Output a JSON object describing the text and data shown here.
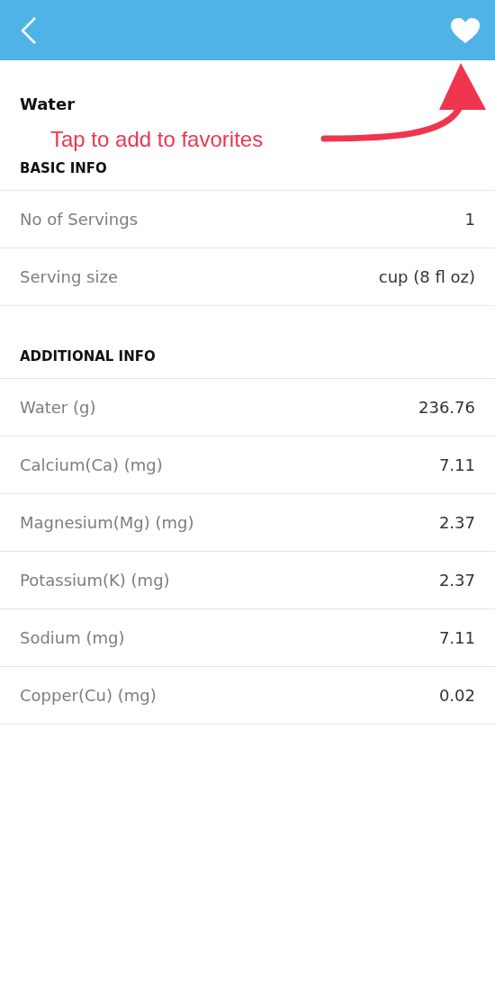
{
  "title": "Water",
  "annotation": {
    "text": "Tap to add to favorites"
  },
  "sections": [
    {
      "heading": "BASIC INFO",
      "rows": [
        {
          "label": "No of Servings",
          "value": "1"
        },
        {
          "label": "Serving size",
          "value": "cup (8 fl oz)"
        }
      ]
    },
    {
      "heading": "ADDITIONAL INFO",
      "rows": [
        {
          "label": "Water (g)",
          "value": "236.76"
        },
        {
          "label": "Calcium(Ca) (mg)",
          "value": "7.11"
        },
        {
          "label": "Magnesium(Mg) (mg)",
          "value": "2.37"
        },
        {
          "label": "Potassium(K) (mg)",
          "value": "2.37"
        },
        {
          "label": "Sodium (mg)",
          "value": "7.11"
        },
        {
          "label": "Copper(Cu) (mg)",
          "value": "0.02"
        }
      ]
    }
  ]
}
